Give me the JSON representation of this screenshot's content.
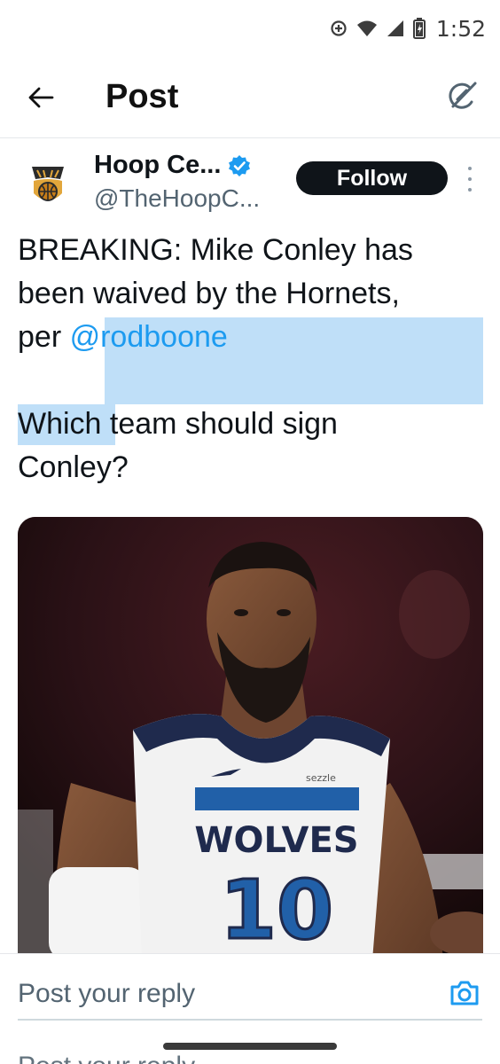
{
  "status_bar": {
    "time": "1:52",
    "icons": [
      "data-saver-icon",
      "wifi-icon",
      "signal-icon",
      "battery-charging-icon"
    ]
  },
  "header": {
    "title": "Post",
    "back_icon": "arrow-left-icon",
    "grok_icon": "grok-icon"
  },
  "author": {
    "name": "Hoop Ce...",
    "handle": "@TheHoopC...",
    "verified": true,
    "follow_label": "Follow",
    "more_icon": "more-vertical-icon"
  },
  "post": {
    "line1": "BREAKING: Mike Conley has",
    "line2": "been waived by the Hornets,",
    "line3_prefix": "per ",
    "mention": "@rodboone",
    "line4": "Which team should sign",
    "line5": "Conley?"
  },
  "media": {
    "jersey_team": "WOLVES",
    "jersey_number": "10",
    "jersey_sponsor": "sezzle"
  },
  "reply": {
    "placeholder": "Post your reply",
    "ghost_placeholder": "Post your reply",
    "camera_icon": "camera-icon"
  },
  "colors": {
    "accent": "#1d9bf0",
    "selection": "#bfdff8",
    "follow_bg": "#0f1419",
    "verified": "#1d9bf0"
  }
}
